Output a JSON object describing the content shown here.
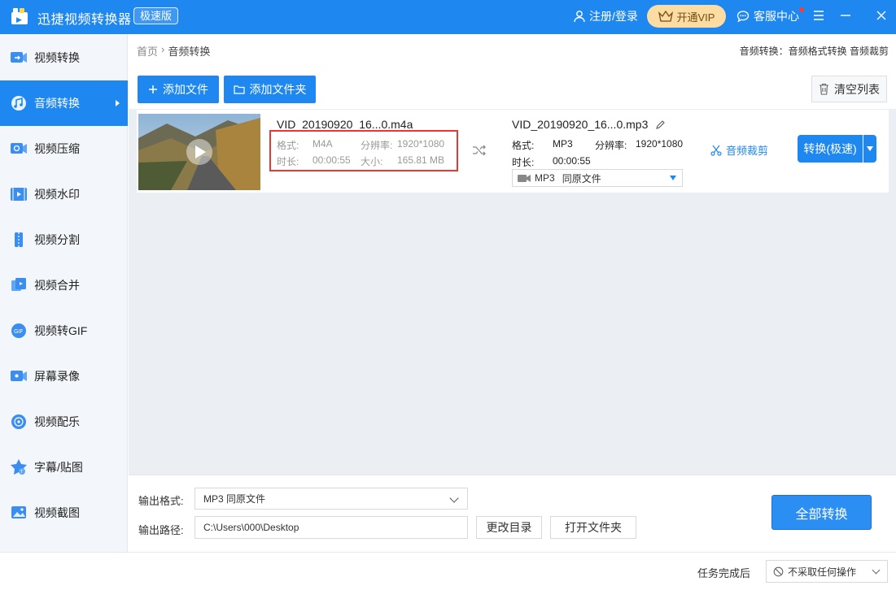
{
  "app": {
    "title": "迅捷视频转换器",
    "badge": "极速版",
    "login": "注册/登录",
    "vip": "开通VIP",
    "service": "客服中心"
  },
  "sidebar": {
    "items": [
      {
        "label": "视频转换",
        "icon": "video-convert-icon"
      },
      {
        "label": "音频转换",
        "icon": "audio-convert-icon"
      },
      {
        "label": "视频压缩",
        "icon": "video-compress-icon"
      },
      {
        "label": "视频水印",
        "icon": "video-watermark-icon"
      },
      {
        "label": "视频分割",
        "icon": "video-split-icon"
      },
      {
        "label": "视频合并",
        "icon": "video-merge-icon"
      },
      {
        "label": "视频转GIF",
        "icon": "gif-icon"
      },
      {
        "label": "屏幕录像",
        "icon": "screen-record-icon"
      },
      {
        "label": "视频配乐",
        "icon": "music-icon"
      },
      {
        "label": "字幕/贴图",
        "icon": "subtitle-sticker-icon"
      },
      {
        "label": "视频截图",
        "icon": "screenshot-icon"
      }
    ],
    "active_index": 1
  },
  "breadcrumb": {
    "home": "首页",
    "separator": "›",
    "current": "音频转换"
  },
  "top_links": "音频转换：音频格式转换 音频裁剪",
  "toolbar": {
    "add_file": "添加文件",
    "add_folder": "添加文件夹",
    "clear_list": "清空列表"
  },
  "file": {
    "source_name": "VID_20190920_16...0.m4a",
    "source": {
      "format_label": "格式:",
      "format": "M4A",
      "resolution_label": "分辨率:",
      "resolution": "1920*1080",
      "duration_label": "时长:",
      "duration": "00:00:55",
      "size_label": "大小:",
      "size": "165.81 MB"
    },
    "target_name": "VID_20190920_16...0.mp3",
    "target": {
      "format_label": "格式:",
      "format": "MP3",
      "resolution_label": "分辨率:",
      "resolution": "1920*1080",
      "duration_label": "时长:",
      "duration": "00:00:55"
    },
    "format_select": "MP3",
    "quality_select": "同原文件",
    "cut_label": "音频裁剪",
    "convert_label": "转换(极速)"
  },
  "output": {
    "format_label": "输出格式:",
    "format_value": "MP3  同原文件",
    "path_label": "输出路径:",
    "path_value": "C:\\Users\\000\\Desktop",
    "change_dir": "更改目录",
    "open_folder": "打开文件夹",
    "convert_all": "全部转换"
  },
  "status": {
    "after_label": "任务完成后",
    "after_value": "不采取任何操作"
  },
  "colors": {
    "primary": "#1e88f0",
    "vip": "#fbdda4",
    "highlight": "#e53935"
  }
}
